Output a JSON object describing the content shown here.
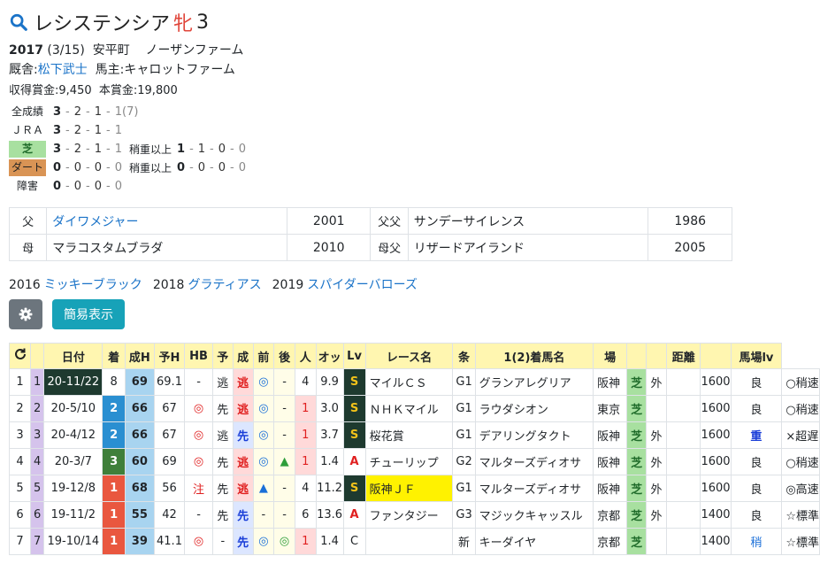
{
  "horse": {
    "name": "レシステンシア",
    "sex": "牝",
    "age": "3",
    "birth_year": "2017",
    "birth_date": "(3/15)",
    "birthplace": "安平町",
    "breeder": "ノーザンファーム",
    "trainer_label": "厩舎:",
    "trainer": "松下武士",
    "owner_label": "馬主:",
    "owner": "キャロットファーム",
    "earnings_label": "収得賞金:",
    "earnings": "9,450",
    "prize_label": "本賞金:",
    "prize": "19,800"
  },
  "record": [
    {
      "label": "全成績",
      "style": "",
      "vals": [
        "3",
        "2",
        "1",
        "1"
      ],
      "extra_paren": "(7)",
      "sub": null
    },
    {
      "label": "ＪＲＡ",
      "style": "",
      "vals": [
        "3",
        "2",
        "1",
        "1"
      ],
      "extra_paren": "",
      "sub": null
    },
    {
      "label": "芝",
      "style": "turf",
      "vals": [
        "3",
        "2",
        "1",
        "1"
      ],
      "extra_paren": "",
      "sub": {
        "label": "稍重以上",
        "vals": [
          "1",
          "1",
          "0",
          "0"
        ]
      }
    },
    {
      "label": "ダート",
      "style": "dirt",
      "vals": [
        "0",
        "0",
        "0",
        "0"
      ],
      "extra_paren": "",
      "sub": {
        "label": "稍重以上",
        "vals": [
          "0",
          "0",
          "0",
          "0"
        ]
      }
    },
    {
      "label": "障害",
      "style": "",
      "vals": [
        "0",
        "0",
        "0",
        "0"
      ],
      "extra_paren": "",
      "sub": null
    }
  ],
  "pedigree": {
    "sire_label": "父",
    "sire": "ダイワメジャー",
    "sire_year": "2001",
    "sire_sire_label": "父父",
    "sire_sire": "サンデーサイレンス",
    "sire_sire_year": "1986",
    "dam_label": "母",
    "dam": "マラコスタムブラダ",
    "dam_year": "2010",
    "dam_sire_label": "母父",
    "dam_sire": "リザードアイランド",
    "dam_sire_year": "2005"
  },
  "siblings": [
    {
      "year": "2016",
      "name": "ミッキーブラック"
    },
    {
      "year": "2018",
      "name": "グラティアス"
    },
    {
      "year": "2019",
      "name": "スパイダーバローズ"
    }
  ],
  "buttons": {
    "settings_icon": "gear-icon",
    "simple_view": "簡易表示"
  },
  "table": {
    "headers": [
      "日付",
      "着",
      "成H",
      "予H",
      "HB",
      "予",
      "成",
      "前",
      "後",
      "人",
      "オッ",
      "Lv",
      "レース名",
      "条",
      "1(2)着馬名",
      "場",
      "",
      "",
      "距離",
      "",
      "馬場lv"
    ],
    "rows": [
      {
        "n": "1",
        "n2": "1",
        "date": "20-11/22",
        "fin": "8",
        "finCls": "",
        "seh": "69",
        "yoh": "69.1",
        "hb": "-",
        "hbCls": "",
        "yo": "逃",
        "sei": "逃",
        "seiCls": "run-red",
        "mae": "◎",
        "maeCls": "blue",
        "ato": "-",
        "atoCls": "",
        "pop": "4",
        "popCls": "",
        "odds": "9.9",
        "lv": "S",
        "lvCls": "lvS",
        "race": "マイルＣＳ",
        "raceCls": "",
        "grade": "G1",
        "winner": "グランアレグリア",
        "track": "阪神",
        "surf": "芝",
        "inout": "外",
        "dist": "1600",
        "cond": "良",
        "condCls": "",
        "blv": "○稍速"
      },
      {
        "n": "2",
        "n2": "2",
        "date": "20-5/10",
        "fin": "2",
        "finCls": "f2",
        "seh": "66",
        "yoh": "67",
        "hb": "◎",
        "hbCls": "red",
        "yo": "先",
        "sei": "逃",
        "seiCls": "run-red",
        "mae": "◎",
        "maeCls": "blue",
        "ato": "-",
        "atoCls": "",
        "pop": "1",
        "popCls": "pink red",
        "odds": "3.0",
        "lv": "S",
        "lvCls": "lvS",
        "race": "ＮＨＫマイル",
        "raceCls": "",
        "grade": "G1",
        "winner": "ラウダシオン",
        "track": "東京",
        "surf": "芝",
        "inout": "",
        "dist": "1600",
        "cond": "良",
        "condCls": "",
        "blv": "○稍速"
      },
      {
        "n": "3",
        "n2": "3",
        "date": "20-4/12",
        "fin": "2",
        "finCls": "f2",
        "seh": "66",
        "yoh": "67",
        "hb": "◎",
        "hbCls": "red",
        "yo": "逃",
        "sei": "先",
        "seiCls": "run-blue",
        "mae": "◎",
        "maeCls": "blue",
        "ato": "-",
        "atoCls": "",
        "pop": "1",
        "popCls": "pink red",
        "odds": "3.7",
        "lv": "S",
        "lvCls": "lvS",
        "race": "桜花賞",
        "raceCls": "",
        "grade": "G1",
        "winner": "デアリングタクト",
        "track": "阪神",
        "surf": "芝",
        "inout": "外",
        "dist": "1600",
        "cond": "重",
        "condCls": "heavy",
        "blv": "×超遅"
      },
      {
        "n": "4",
        "n2": "4",
        "date": "20-3/7",
        "fin": "3",
        "finCls": "f3",
        "seh": "60",
        "yoh": "69",
        "hb": "◎",
        "hbCls": "red",
        "yo": "先",
        "sei": "逃",
        "seiCls": "run-red",
        "mae": "◎",
        "maeCls": "blue",
        "ato": "▲",
        "atoCls": "tri-g",
        "pop": "1",
        "popCls": "pink red",
        "odds": "1.4",
        "lv": "A",
        "lvCls": "lvA",
        "race": "チューリップ",
        "raceCls": "",
        "grade": "G2",
        "winner": "マルターズディオサ",
        "track": "阪神",
        "surf": "芝",
        "inout": "外",
        "dist": "1600",
        "cond": "良",
        "condCls": "",
        "blv": "○稍速"
      },
      {
        "n": "5",
        "n2": "5",
        "date": "19-12/8",
        "fin": "1",
        "finCls": "f1",
        "seh": "68",
        "yoh": "56",
        "hb": "注",
        "hbCls": "red",
        "yo": "先",
        "sei": "逃",
        "seiCls": "run-red",
        "mae": "▲",
        "maeCls": "tri-b",
        "ato": "-",
        "atoCls": "",
        "pop": "4",
        "popCls": "",
        "odds": "11.2",
        "lv": "S",
        "lvCls": "lvS",
        "race": "阪神ＪＦ",
        "raceCls": "hl",
        "grade": "G1",
        "winner": "マルターズディオサ",
        "track": "阪神",
        "surf": "芝",
        "inout": "外",
        "dist": "1600",
        "cond": "良",
        "condCls": "",
        "blv": "◎高速"
      },
      {
        "n": "6",
        "n2": "6",
        "date": "19-11/2",
        "fin": "1",
        "finCls": "f1",
        "seh": "55",
        "yoh": "42",
        "hb": "-",
        "hbCls": "",
        "yo": "先",
        "sei": "先",
        "seiCls": "run-blue",
        "mae": "-",
        "maeCls": "",
        "ato": "-",
        "atoCls": "",
        "pop": "6",
        "popCls": "",
        "odds": "13.6",
        "lv": "A",
        "lvCls": "lvA",
        "race": "ファンタジー",
        "raceCls": "",
        "grade": "G3",
        "winner": "マジックキャッスル",
        "track": "京都",
        "surf": "芝",
        "inout": "外",
        "dist": "1400",
        "cond": "良",
        "condCls": "",
        "blv": "☆標準"
      },
      {
        "n": "7",
        "n2": "7",
        "date": "19-10/14",
        "fin": "1",
        "finCls": "f1",
        "seh": "39",
        "yoh": "41.1",
        "hb": "◎",
        "hbCls": "red",
        "yo": "-",
        "sei": "先",
        "seiCls": "run-blue",
        "mae": "◎",
        "maeCls": "blue",
        "ato": "◎",
        "atoCls": "tri-g",
        "pop": "1",
        "popCls": "pink red",
        "odds": "1.4",
        "lv": "C",
        "lvCls": "",
        "race": "",
        "raceCls": "",
        "grade": "新",
        "winner": "キーダイヤ",
        "track": "京都",
        "surf": "芝",
        "inout": "",
        "dist": "1400",
        "cond": "稍",
        "condCls": "slight",
        "blv": "☆標準"
      }
    ]
  }
}
